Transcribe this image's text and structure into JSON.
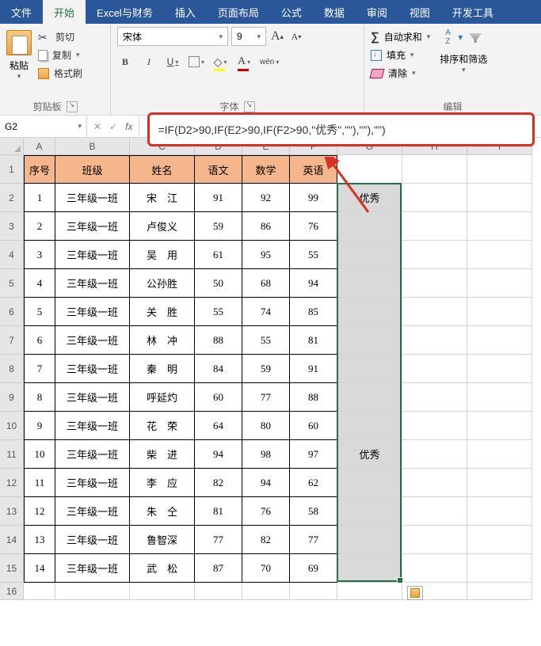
{
  "menu": {
    "tabs": [
      "文件",
      "开始",
      "Excel与财务",
      "插入",
      "页面布局",
      "公式",
      "数据",
      "审阅",
      "视图",
      "开发工具"
    ],
    "active": 1
  },
  "ribbon": {
    "clipboard": {
      "paste": "粘贴",
      "cut": "剪切",
      "copy": "复制",
      "format_painter": "格式刷",
      "group_label": "剪贴板"
    },
    "font": {
      "name": "宋体",
      "size": "9",
      "bold": "B",
      "italic": "I",
      "underline": "U",
      "wen": "wén",
      "group_label": "字体"
    },
    "editing": {
      "autosum": "自动求和",
      "fill": "填充",
      "clear": "清除",
      "sort_filter": "排序和筛选",
      "group_label": "编辑"
    }
  },
  "name_box": "G2",
  "formula": "=IF(D2>90,IF(E2>90,IF(F2>90,\"优秀\",\"\"),\"\"),\"\")",
  "columns": [
    "A",
    "B",
    "C",
    "D",
    "E",
    "F",
    "G",
    "H",
    "I"
  ],
  "header_row": [
    "序号",
    "班级",
    "姓名",
    "语文",
    "数学",
    "英语"
  ],
  "rows": [
    {
      "n": "1",
      "cls": "三年级一班",
      "name": "宋　江",
      "d": "91",
      "e": "92",
      "f": "99",
      "g": "优秀"
    },
    {
      "n": "2",
      "cls": "三年级一班",
      "name": "卢俊义",
      "d": "59",
      "e": "86",
      "f": "76",
      "g": ""
    },
    {
      "n": "3",
      "cls": "三年级一班",
      "name": "吴　用",
      "d": "61",
      "e": "95",
      "f": "55",
      "g": ""
    },
    {
      "n": "4",
      "cls": "三年级一班",
      "name": "公孙胜",
      "d": "50",
      "e": "68",
      "f": "94",
      "g": ""
    },
    {
      "n": "5",
      "cls": "三年级一班",
      "name": "关　胜",
      "d": "55",
      "e": "74",
      "f": "85",
      "g": ""
    },
    {
      "n": "6",
      "cls": "三年级一班",
      "name": "林　冲",
      "d": "88",
      "e": "55",
      "f": "81",
      "g": ""
    },
    {
      "n": "7",
      "cls": "三年级一班",
      "name": "秦　明",
      "d": "84",
      "e": "59",
      "f": "91",
      "g": ""
    },
    {
      "n": "8",
      "cls": "三年级一班",
      "name": "呼延灼",
      "d": "60",
      "e": "77",
      "f": "88",
      "g": ""
    },
    {
      "n": "9",
      "cls": "三年级一班",
      "name": "花　荣",
      "d": "64",
      "e": "80",
      "f": "60",
      "g": ""
    },
    {
      "n": "10",
      "cls": "三年级一班",
      "name": "柴　进",
      "d": "94",
      "e": "98",
      "f": "97",
      "g": "优秀"
    },
    {
      "n": "11",
      "cls": "三年级一班",
      "name": "李　应",
      "d": "82",
      "e": "94",
      "f": "62",
      "g": ""
    },
    {
      "n": "12",
      "cls": "三年级一班",
      "name": "朱　仝",
      "d": "81",
      "e": "76",
      "f": "58",
      "g": ""
    },
    {
      "n": "13",
      "cls": "三年级一班",
      "name": "鲁智深",
      "d": "77",
      "e": "82",
      "f": "77",
      "g": ""
    },
    {
      "n": "14",
      "cls": "三年级一班",
      "name": "武　松",
      "d": "87",
      "e": "70",
      "f": "69",
      "g": ""
    }
  ]
}
